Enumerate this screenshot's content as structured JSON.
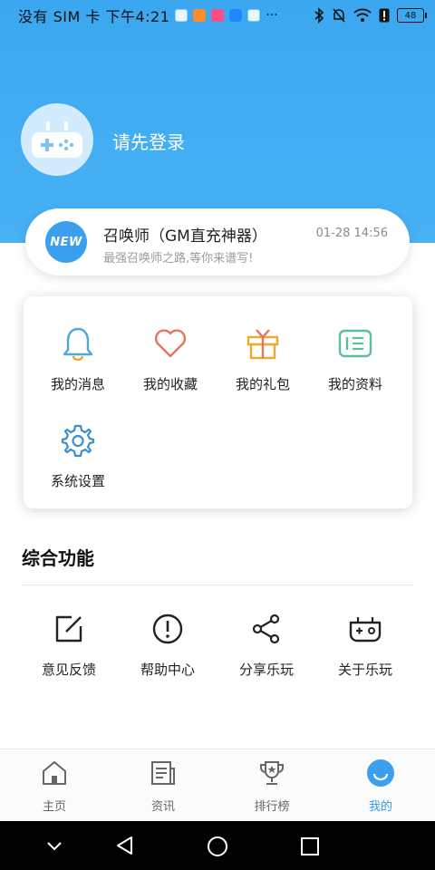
{
  "status_bar": {
    "carrier": "没有 SIM 卡 下午4:21",
    "dots": "···",
    "battery": "48"
  },
  "profile": {
    "login_prompt": "请先登录",
    "avatar_icon": "gamepad-icon"
  },
  "news": {
    "badge": "NEW",
    "title": "召唤师（GM直充神器）",
    "subtitle": "最强召唤师之路,等你来谱写!",
    "time": "01-28 14:56"
  },
  "shortcuts": {
    "items": [
      {
        "label": "我的消息",
        "icon": "bell-icon",
        "color": "#52a7d8"
      },
      {
        "label": "我的收藏",
        "icon": "heart-icon",
        "color": "#e8735f"
      },
      {
        "label": "我的礼包",
        "icon": "gift-icon",
        "color": "#f0a72e"
      },
      {
        "label": "我的资料",
        "icon": "profile-card-icon",
        "color": "#5bbf9a"
      },
      {
        "label": "系统设置",
        "icon": "gear-icon",
        "color": "#3b8fd0"
      }
    ]
  },
  "features": {
    "title": "综合功能",
    "items": [
      {
        "label": "意见反馈",
        "icon": "edit-icon"
      },
      {
        "label": "帮助中心",
        "icon": "alert-circle-icon"
      },
      {
        "label": "分享乐玩",
        "icon": "share-icon"
      },
      {
        "label": "关于乐玩",
        "icon": "controller-icon"
      }
    ]
  },
  "bottom_nav": {
    "items": [
      {
        "label": "主页",
        "icon": "home-icon"
      },
      {
        "label": "资讯",
        "icon": "news-icon"
      },
      {
        "label": "排行榜",
        "icon": "trophy-icon"
      },
      {
        "label": "我的",
        "icon": "smile-icon",
        "active": true
      }
    ]
  },
  "colors": {
    "accent": "#2f9bee",
    "header": "#3aa7f0"
  }
}
